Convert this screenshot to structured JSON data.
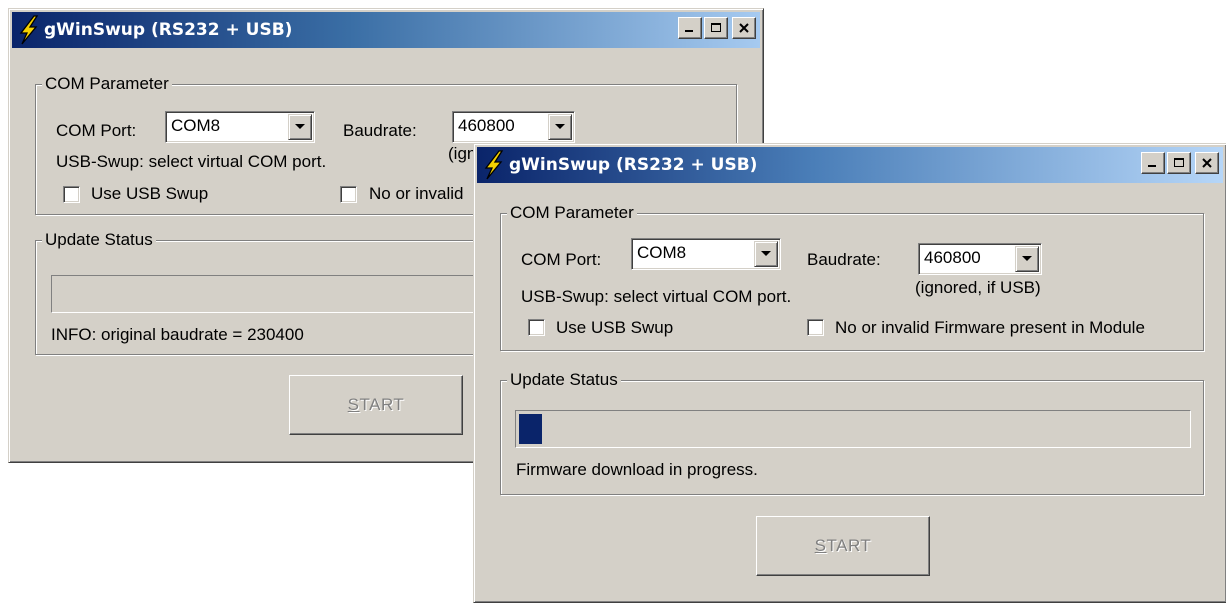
{
  "colors": {
    "titlebar_active": "#0a246a",
    "window_face": "#d4d0c8",
    "progress_fill": "#0a246a",
    "disabled_text": "#808080"
  },
  "icons": {
    "app": "lightning-bolt-icon",
    "minimize": "minimize-icon",
    "maximize": "maximize-icon",
    "close": "close-icon",
    "dropdown": "chevron-down-icon"
  },
  "back_window": {
    "title": "gWinSwup (RS232 + USB)",
    "com_group": {
      "legend": "COM Parameter",
      "com_port_label": "COM Port:",
      "com_port_value": "COM8",
      "baudrate_label": "Baudrate:",
      "baudrate_value": "460800",
      "baudrate_note": "(ign",
      "usb_hint": "USB-Swup: select virtual COM port.",
      "use_usb_label": "Use USB Swup",
      "use_usb_checked": false,
      "no_fw_label": "No or invalid",
      "no_fw_checked": false
    },
    "status_group": {
      "legend": "Update Status",
      "progress": 0,
      "info": "INFO: original baudrate = 230400"
    },
    "start": {
      "first": "S",
      "rest": "TART",
      "enabled": false
    }
  },
  "front_window": {
    "title": "gWinSwup (RS232 + USB)",
    "com_group": {
      "legend": "COM Parameter",
      "com_port_label": "COM Port:",
      "com_port_value": "COM8",
      "baudrate_label": "Baudrate:",
      "baudrate_value": "460800",
      "baudrate_note": "(ignored, if USB)",
      "usb_hint": "USB-Swup: select virtual COM port.",
      "use_usb_label": "Use USB Swup",
      "use_usb_checked": false,
      "no_fw_label": "No or invalid Firmware present in Module",
      "no_fw_checked": false
    },
    "status_group": {
      "legend": "Update Status",
      "progress": 0.035,
      "info": "Firmware download in progress."
    },
    "start": {
      "first": "S",
      "rest": "TART",
      "enabled": false
    }
  }
}
